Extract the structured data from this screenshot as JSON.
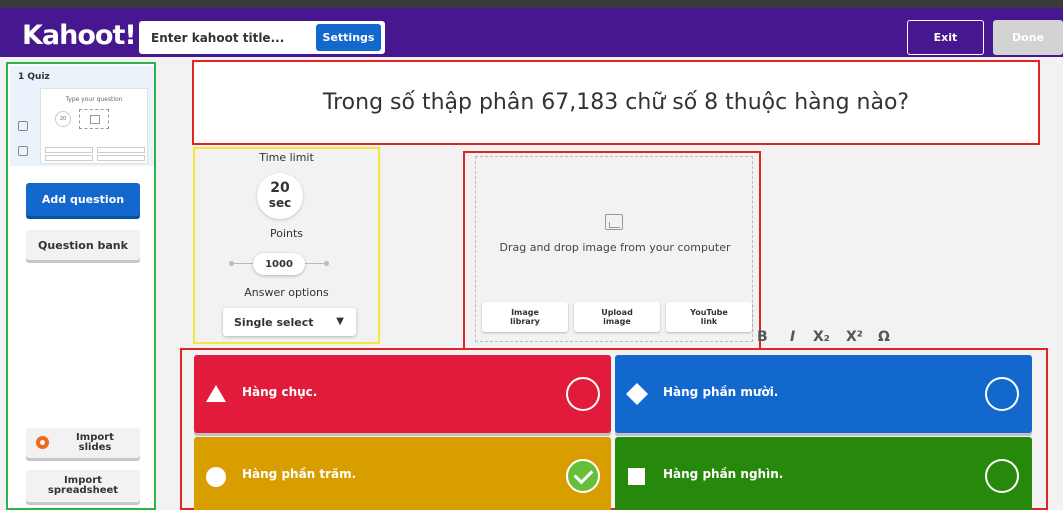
{
  "app": {
    "logo": "Kahoot!"
  },
  "header": {
    "title_placeholder": "Enter kahoot title...",
    "settings_label": "Settings",
    "exit_label": "Exit",
    "done_label": "Done"
  },
  "sidebar": {
    "quiz_label": "1  Quiz",
    "thumb_text": "Type your question",
    "thumb_timer": "20",
    "add_question": "Add question",
    "question_bank": "Question bank",
    "import_slides": "Import slides",
    "import_spreadsheet": "Import spreadsheet"
  },
  "question": {
    "text": "Trong số thập phân 67,183 chữ số 8 thuộc hàng nào?"
  },
  "settings": {
    "time_label": "Time limit",
    "time_value": "20",
    "time_unit": "sec",
    "points_label": "Points",
    "points_value": "1000",
    "answer_options_label": "Answer options",
    "answer_options_value": "Single select"
  },
  "media": {
    "drop_text": "Drag and drop image from your computer",
    "image_library": "Image library",
    "upload_image": "Upload image",
    "youtube_link": "YouTube link"
  },
  "format_toolbar": {
    "bold": "B",
    "italic": "I",
    "subscript": "X₂",
    "superscript": "X²",
    "omega": "Ω"
  },
  "answers": [
    {
      "text": "Hàng chục.",
      "color": "#e21b3c",
      "shape": "triangle",
      "correct": false
    },
    {
      "text": "Hàng phần mười.",
      "color": "#1368ce",
      "shape": "diamond",
      "correct": false
    },
    {
      "text": "Hàng phần trăm.",
      "color": "#d89e00",
      "shape": "circle",
      "correct": true
    },
    {
      "text": "Hàng phần nghìn.",
      "color": "#26890c",
      "shape": "square",
      "correct": false
    }
  ],
  "colors": {
    "brand_purple": "#46178f",
    "accent_blue": "#1368ce"
  }
}
